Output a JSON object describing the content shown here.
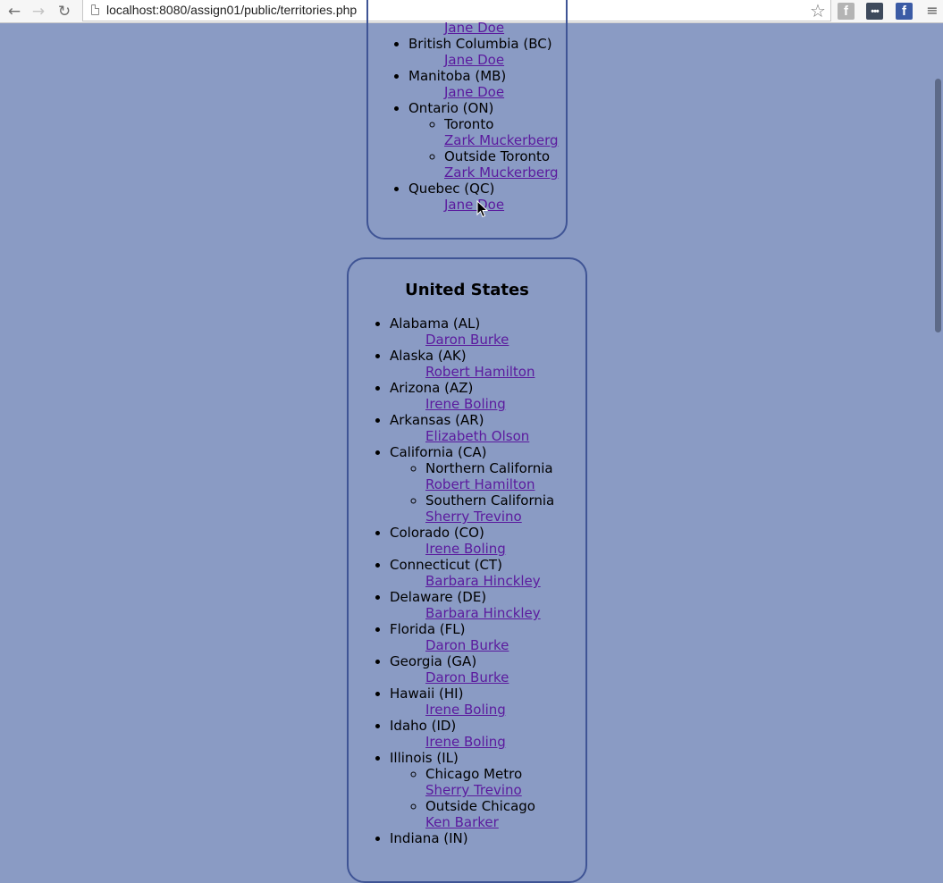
{
  "browser": {
    "url": "localhost:8080/assign01/public/territories.php",
    "back_glyph": "←",
    "forward_glyph": "→",
    "reload_glyph": "↻",
    "star_glyph": "☆",
    "menu_glyph": "≡",
    "extensions": [
      {
        "name": "facebook-gray-extension-icon",
        "glyph": "f"
      },
      {
        "name": "dots-extension-icon",
        "glyph": "•••"
      },
      {
        "name": "facebook-blue-extension-icon",
        "glyph": "f"
      }
    ]
  },
  "canada": {
    "regions": [
      {
        "name": "",
        "rep": "Jane Doe"
      },
      {
        "name": "British Columbia (BC)",
        "rep": "Jane Doe"
      },
      {
        "name": "Manitoba (MB)",
        "rep": "Jane Doe"
      },
      {
        "name": "Ontario (ON)",
        "subregions": [
          {
            "name": "Toronto",
            "rep": "Zark Muckerberg"
          },
          {
            "name": "Outside Toronto",
            "rep": "Zark Muckerberg"
          }
        ]
      },
      {
        "name": "Quebec (QC)",
        "rep": "Jane Doe"
      }
    ]
  },
  "united_states": {
    "title": "United States",
    "regions": [
      {
        "name": "Alabama (AL)",
        "rep": "Daron Burke"
      },
      {
        "name": "Alaska (AK)",
        "rep": "Robert Hamilton"
      },
      {
        "name": "Arizona (AZ)",
        "rep": "Irene Boling"
      },
      {
        "name": "Arkansas (AR)",
        "rep": "Elizabeth Olson"
      },
      {
        "name": "California (CA)",
        "subregions": [
          {
            "name": "Northern California",
            "rep": "Robert Hamilton"
          },
          {
            "name": "Southern California",
            "rep": "Sherry Trevino"
          }
        ]
      },
      {
        "name": "Colorado (CO)",
        "rep": "Irene Boling"
      },
      {
        "name": "Connecticut (CT)",
        "rep": "Barbara Hinckley"
      },
      {
        "name": "Delaware (DE)",
        "rep": "Barbara Hinckley"
      },
      {
        "name": "Florida (FL)",
        "rep": "Daron Burke"
      },
      {
        "name": "Georgia (GA)",
        "rep": "Daron Burke"
      },
      {
        "name": "Hawaii (HI)",
        "rep": "Irene Boling"
      },
      {
        "name": "Idaho (ID)",
        "rep": "Irene Boling"
      },
      {
        "name": "Illinois (IL)",
        "subregions": [
          {
            "name": "Chicago Metro",
            "rep": "Sherry Trevino"
          },
          {
            "name": "Outside Chicago",
            "rep": "Ken Barker"
          }
        ]
      },
      {
        "name": "Indiana (IN)",
        "rep": ""
      }
    ]
  },
  "colors": {
    "background": "#8a9bc4",
    "box_border": "#3f5495",
    "link": "#5b1a9e"
  }
}
